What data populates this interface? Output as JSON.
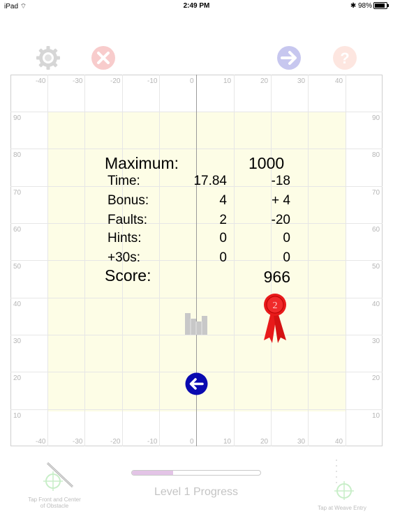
{
  "status_bar": {
    "device": "iPad",
    "time": "2:49 PM",
    "battery": "98%"
  },
  "toolbar": {
    "icons": [
      "gear-icon",
      "close-icon",
      "arrow-right-icon",
      "help-icon"
    ],
    "colors": {
      "gear": "#d6d6d6",
      "close": "#f8cccc",
      "next": "#c7c7ef",
      "help": "#fde6e0"
    }
  },
  "field": {
    "x_ticks": [
      "-40",
      "-30",
      "-20",
      "-10",
      "0",
      "10",
      "20",
      "30",
      "40"
    ],
    "y_ticks": [
      "90",
      "80",
      "70",
      "60",
      "50",
      "40",
      "30",
      "20",
      "10"
    ],
    "background": "#fdfde6"
  },
  "score_panel": {
    "maximum_label": "Maximum:",
    "maximum_value": "1000",
    "rows": [
      {
        "label": "Time:",
        "raw": "17.84",
        "points": "-18"
      },
      {
        "label": "Bonus:",
        "raw": "4",
        "points": "+ 4"
      },
      {
        "label": "Faults:",
        "raw": "2",
        "points": "-20"
      },
      {
        "label": "Hints:",
        "raw": "0",
        "points": "0"
      },
      {
        "label": "+30s:",
        "raw": "0",
        "points": "0"
      }
    ],
    "score_label": "Score:",
    "score_value": "966",
    "ribbon_place": "2",
    "ribbon_color": "#ee1c1c"
  },
  "bottom": {
    "progress_label": "Level 1 Progress",
    "progress_value": 0.32,
    "hint_left": [
      "Tap Front and Center",
      "of Obstacle"
    ],
    "hint_right": "Tap at Weave Entry",
    "back_color": "#0a0ab0"
  }
}
